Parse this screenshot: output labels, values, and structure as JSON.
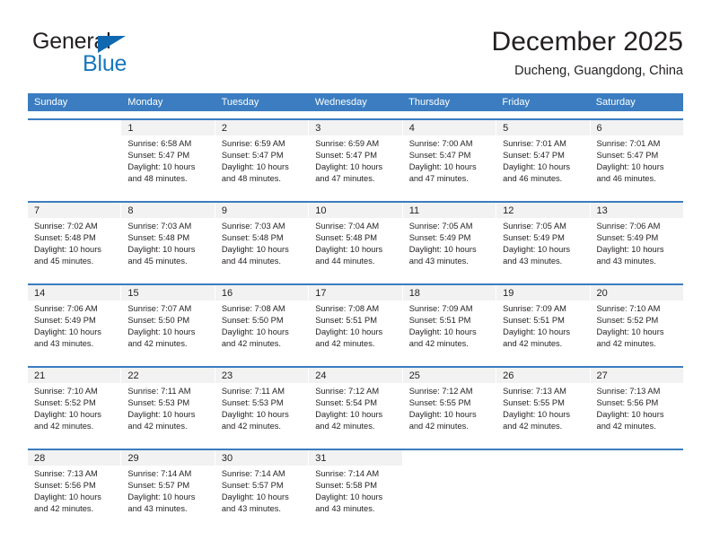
{
  "brand": {
    "name_part1": "General",
    "name_part2": "Blue",
    "triangle_color": "#1069b0",
    "blue_color": "#1878be"
  },
  "header": {
    "title": "December 2025",
    "subtitle": "Ducheng, Guangdong, China"
  },
  "theme": {
    "header_bar": "#3b7dc0",
    "day_number_band": "#f2f2f2",
    "text": "#231f20"
  },
  "weekday_headers": [
    "Sunday",
    "Monday",
    "Tuesday",
    "Wednesday",
    "Thursday",
    "Friday",
    "Saturday"
  ],
  "weeks": [
    [
      {
        "day": "",
        "sunrise": "",
        "sunset": "",
        "daylight1": "",
        "daylight2": "",
        "empty": true
      },
      {
        "day": "1",
        "sunrise": "Sunrise: 6:58 AM",
        "sunset": "Sunset: 5:47 PM",
        "daylight1": "Daylight: 10 hours",
        "daylight2": "and 48 minutes."
      },
      {
        "day": "2",
        "sunrise": "Sunrise: 6:59 AM",
        "sunset": "Sunset: 5:47 PM",
        "daylight1": "Daylight: 10 hours",
        "daylight2": "and 48 minutes."
      },
      {
        "day": "3",
        "sunrise": "Sunrise: 6:59 AM",
        "sunset": "Sunset: 5:47 PM",
        "daylight1": "Daylight: 10 hours",
        "daylight2": "and 47 minutes."
      },
      {
        "day": "4",
        "sunrise": "Sunrise: 7:00 AM",
        "sunset": "Sunset: 5:47 PM",
        "daylight1": "Daylight: 10 hours",
        "daylight2": "and 47 minutes."
      },
      {
        "day": "5",
        "sunrise": "Sunrise: 7:01 AM",
        "sunset": "Sunset: 5:47 PM",
        "daylight1": "Daylight: 10 hours",
        "daylight2": "and 46 minutes."
      },
      {
        "day": "6",
        "sunrise": "Sunrise: 7:01 AM",
        "sunset": "Sunset: 5:47 PM",
        "daylight1": "Daylight: 10 hours",
        "daylight2": "and 46 minutes."
      }
    ],
    [
      {
        "day": "7",
        "sunrise": "Sunrise: 7:02 AM",
        "sunset": "Sunset: 5:48 PM",
        "daylight1": "Daylight: 10 hours",
        "daylight2": "and 45 minutes."
      },
      {
        "day": "8",
        "sunrise": "Sunrise: 7:03 AM",
        "sunset": "Sunset: 5:48 PM",
        "daylight1": "Daylight: 10 hours",
        "daylight2": "and 45 minutes."
      },
      {
        "day": "9",
        "sunrise": "Sunrise: 7:03 AM",
        "sunset": "Sunset: 5:48 PM",
        "daylight1": "Daylight: 10 hours",
        "daylight2": "and 44 minutes."
      },
      {
        "day": "10",
        "sunrise": "Sunrise: 7:04 AM",
        "sunset": "Sunset: 5:48 PM",
        "daylight1": "Daylight: 10 hours",
        "daylight2": "and 44 minutes."
      },
      {
        "day": "11",
        "sunrise": "Sunrise: 7:05 AM",
        "sunset": "Sunset: 5:49 PM",
        "daylight1": "Daylight: 10 hours",
        "daylight2": "and 43 minutes."
      },
      {
        "day": "12",
        "sunrise": "Sunrise: 7:05 AM",
        "sunset": "Sunset: 5:49 PM",
        "daylight1": "Daylight: 10 hours",
        "daylight2": "and 43 minutes."
      },
      {
        "day": "13",
        "sunrise": "Sunrise: 7:06 AM",
        "sunset": "Sunset: 5:49 PM",
        "daylight1": "Daylight: 10 hours",
        "daylight2": "and 43 minutes."
      }
    ],
    [
      {
        "day": "14",
        "sunrise": "Sunrise: 7:06 AM",
        "sunset": "Sunset: 5:49 PM",
        "daylight1": "Daylight: 10 hours",
        "daylight2": "and 43 minutes."
      },
      {
        "day": "15",
        "sunrise": "Sunrise: 7:07 AM",
        "sunset": "Sunset: 5:50 PM",
        "daylight1": "Daylight: 10 hours",
        "daylight2": "and 42 minutes."
      },
      {
        "day": "16",
        "sunrise": "Sunrise: 7:08 AM",
        "sunset": "Sunset: 5:50 PM",
        "daylight1": "Daylight: 10 hours",
        "daylight2": "and 42 minutes."
      },
      {
        "day": "17",
        "sunrise": "Sunrise: 7:08 AM",
        "sunset": "Sunset: 5:51 PM",
        "daylight1": "Daylight: 10 hours",
        "daylight2": "and 42 minutes."
      },
      {
        "day": "18",
        "sunrise": "Sunrise: 7:09 AM",
        "sunset": "Sunset: 5:51 PM",
        "daylight1": "Daylight: 10 hours",
        "daylight2": "and 42 minutes."
      },
      {
        "day": "19",
        "sunrise": "Sunrise: 7:09 AM",
        "sunset": "Sunset: 5:51 PM",
        "daylight1": "Daylight: 10 hours",
        "daylight2": "and 42 minutes."
      },
      {
        "day": "20",
        "sunrise": "Sunrise: 7:10 AM",
        "sunset": "Sunset: 5:52 PM",
        "daylight1": "Daylight: 10 hours",
        "daylight2": "and 42 minutes."
      }
    ],
    [
      {
        "day": "21",
        "sunrise": "Sunrise: 7:10 AM",
        "sunset": "Sunset: 5:52 PM",
        "daylight1": "Daylight: 10 hours",
        "daylight2": "and 42 minutes."
      },
      {
        "day": "22",
        "sunrise": "Sunrise: 7:11 AM",
        "sunset": "Sunset: 5:53 PM",
        "daylight1": "Daylight: 10 hours",
        "daylight2": "and 42 minutes."
      },
      {
        "day": "23",
        "sunrise": "Sunrise: 7:11 AM",
        "sunset": "Sunset: 5:53 PM",
        "daylight1": "Daylight: 10 hours",
        "daylight2": "and 42 minutes."
      },
      {
        "day": "24",
        "sunrise": "Sunrise: 7:12 AM",
        "sunset": "Sunset: 5:54 PM",
        "daylight1": "Daylight: 10 hours",
        "daylight2": "and 42 minutes."
      },
      {
        "day": "25",
        "sunrise": "Sunrise: 7:12 AM",
        "sunset": "Sunset: 5:55 PM",
        "daylight1": "Daylight: 10 hours",
        "daylight2": "and 42 minutes."
      },
      {
        "day": "26",
        "sunrise": "Sunrise: 7:13 AM",
        "sunset": "Sunset: 5:55 PM",
        "daylight1": "Daylight: 10 hours",
        "daylight2": "and 42 minutes."
      },
      {
        "day": "27",
        "sunrise": "Sunrise: 7:13 AM",
        "sunset": "Sunset: 5:56 PM",
        "daylight1": "Daylight: 10 hours",
        "daylight2": "and 42 minutes."
      }
    ],
    [
      {
        "day": "28",
        "sunrise": "Sunrise: 7:13 AM",
        "sunset": "Sunset: 5:56 PM",
        "daylight1": "Daylight: 10 hours",
        "daylight2": "and 42 minutes."
      },
      {
        "day": "29",
        "sunrise": "Sunrise: 7:14 AM",
        "sunset": "Sunset: 5:57 PM",
        "daylight1": "Daylight: 10 hours",
        "daylight2": "and 43 minutes."
      },
      {
        "day": "30",
        "sunrise": "Sunrise: 7:14 AM",
        "sunset": "Sunset: 5:57 PM",
        "daylight1": "Daylight: 10 hours",
        "daylight2": "and 43 minutes."
      },
      {
        "day": "31",
        "sunrise": "Sunrise: 7:14 AM",
        "sunset": "Sunset: 5:58 PM",
        "daylight1": "Daylight: 10 hours",
        "daylight2": "and 43 minutes."
      },
      {
        "day": "",
        "sunrise": "",
        "sunset": "",
        "daylight1": "",
        "daylight2": "",
        "empty": true
      },
      {
        "day": "",
        "sunrise": "",
        "sunset": "",
        "daylight1": "",
        "daylight2": "",
        "empty": true
      },
      {
        "day": "",
        "sunrise": "",
        "sunset": "",
        "daylight1": "",
        "daylight2": "",
        "empty": true
      }
    ]
  ]
}
